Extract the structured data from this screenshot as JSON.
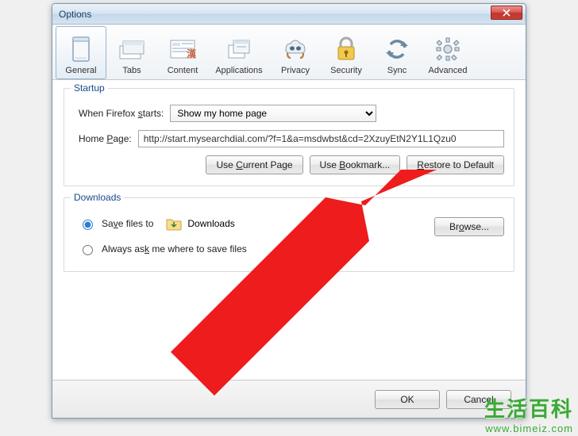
{
  "window": {
    "title": "Options"
  },
  "toolbar": {
    "items": [
      {
        "id": "general",
        "label": "General",
        "active": true
      },
      {
        "id": "tabs",
        "label": "Tabs"
      },
      {
        "id": "content",
        "label": "Content"
      },
      {
        "id": "applications",
        "label": "Applications"
      },
      {
        "id": "privacy",
        "label": "Privacy"
      },
      {
        "id": "security",
        "label": "Security"
      },
      {
        "id": "sync",
        "label": "Sync"
      },
      {
        "id": "advanced",
        "label": "Advanced"
      }
    ]
  },
  "startup": {
    "legend": "Startup",
    "when_label_pre": "When Firefox ",
    "when_label_u": "s",
    "when_label_post": "tarts:",
    "when_value": "Show my home page",
    "homepage_label_pre": "Home ",
    "homepage_label_u": "P",
    "homepage_label_post": "age:",
    "homepage_value": "http://start.mysearchdial.com/?f=1&a=msdwbst&cd=2XzuyEtN2Y1L1Qzu0",
    "btn_current_pre": "Use ",
    "btn_current_u": "C",
    "btn_current_post": "urrent Page",
    "btn_bookmark_pre": "Use ",
    "btn_bookmark_u": "B",
    "btn_bookmark_post": "ookmark...",
    "btn_restore_u": "R",
    "btn_restore_post": "estore to Default"
  },
  "downloads": {
    "legend": "Downloads",
    "save_pre": "Sa",
    "save_u": "v",
    "save_post": "e files to",
    "path": "Downloads",
    "browse_pre": "Br",
    "browse_u": "o",
    "browse_post": "wse...",
    "ask_pre": "Always as",
    "ask_u": "k",
    "ask_post": " me where to save files"
  },
  "footer": {
    "ok": "OK",
    "cancel": "Cancel"
  },
  "watermark": {
    "cn": "生活百科",
    "url": "www.bimeiz.com"
  }
}
